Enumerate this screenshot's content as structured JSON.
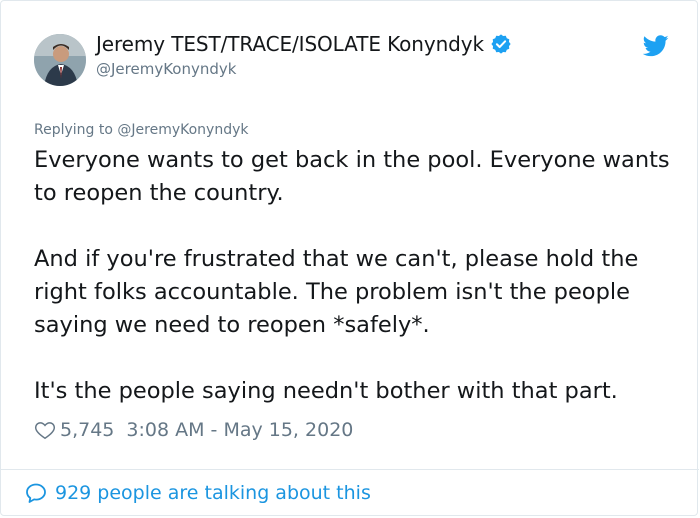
{
  "author": {
    "display_name": "Jeremy TEST/TRACE/ISOLATE Konyndyk",
    "handle": "@JeremyKonyndyk",
    "verified": true,
    "avatar_icon": "profile-photo"
  },
  "reply": {
    "prefix": "Replying to ",
    "handle": "@JeremyKonyndyk"
  },
  "tweet": {
    "paragraphs": [
      "Everyone wants to get back in the pool. Everyone wants to reopen the country.",
      "And if you're frustrated that we can't, please hold the right folks accountable. The problem isn't the people saying we need to reopen *safely*.",
      "It's the people saying needn't bother with that part."
    ],
    "likes": "5,745",
    "timestamp": "3:08 AM - May 15, 2020"
  },
  "footer": {
    "talking_text": "929 people are talking about this"
  },
  "colors": {
    "accent": "#1b95e0",
    "twitter_blue": "#1da1f2",
    "muted": "#657786",
    "text": "#14171a"
  },
  "icons": {
    "verified": "verified-badge-icon",
    "brand": "twitter-bird-icon",
    "like": "heart-icon",
    "talking": "speech-bubble-icon"
  }
}
